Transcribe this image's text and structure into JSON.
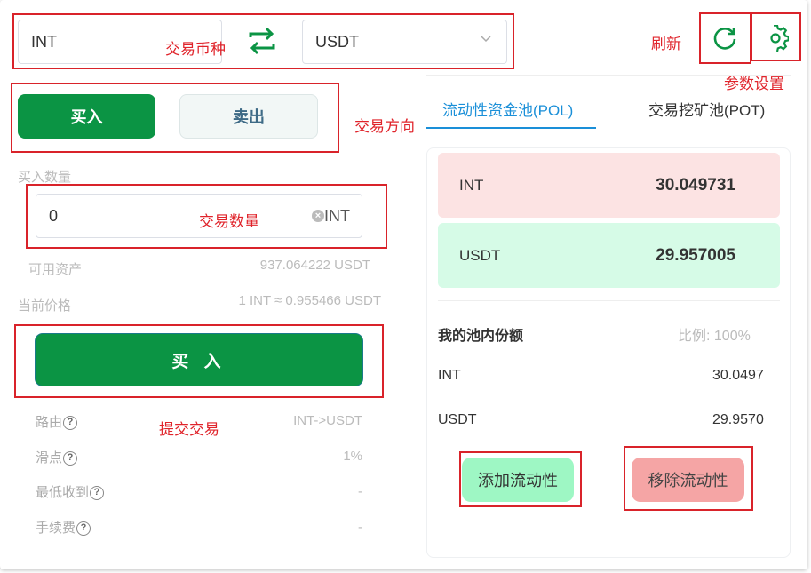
{
  "pair": {
    "from_token": "INT",
    "to_token": "USDT"
  },
  "direction": {
    "buy_label": "买入",
    "sell_label": "卖出"
  },
  "amount": {
    "label": "买入数量",
    "value": "0",
    "unit": "INT"
  },
  "info": {
    "available_label": "可用资产",
    "available_value": "937.064222 USDT",
    "price_label": "当前价格",
    "price_value": "1 INT ≈ 0.955466 USDT"
  },
  "submit": {
    "label": "买 入"
  },
  "details": {
    "route_label": "路由",
    "route_value": "INT->USDT",
    "slippage_label": "滑点",
    "slippage_value": "1%",
    "min_receive_label": "最低收到",
    "min_receive_value": "-",
    "fee_label": "手续费",
    "fee_value": "-"
  },
  "tabs": {
    "pol_label": "流动性资金池(POL)",
    "pot_label": "交易挖矿池(POT)"
  },
  "pool": {
    "token_a_name": "INT",
    "token_a_value": "30.049731",
    "token_b_name": "USDT",
    "token_b_value": "29.957005"
  },
  "my_share": {
    "title": "我的池内份额",
    "ratio": "比例: 100%",
    "token_a_name": "INT",
    "token_a_value": "30.0497",
    "token_b_name": "USDT",
    "token_b_value": "29.9570"
  },
  "liquidity": {
    "add_label": "添加流动性",
    "remove_label": "移除流动性"
  },
  "annotations": {
    "trade_pair": "交易币种",
    "refresh": "刷新",
    "settings": "参数设置",
    "direction": "交易方向",
    "amount": "交易数量",
    "submit": "提交交易"
  },
  "icons": {
    "swap": "swap-icon",
    "refresh": "refresh-icon",
    "settings": "gear-icon",
    "chevron": "chevron-down-icon",
    "clear": "clear-icon",
    "help": "question-circle-icon"
  },
  "colors": {
    "primary_green": "#0b9444",
    "annotation_red": "#e0242b",
    "tab_active_blue": "#1a8fd8",
    "pool_a_bg": "#fce3e3",
    "pool_b_bg": "#d6fbe7",
    "add_btn_bg": "#9ef7c4",
    "remove_btn_bg": "#f5a5a5"
  }
}
